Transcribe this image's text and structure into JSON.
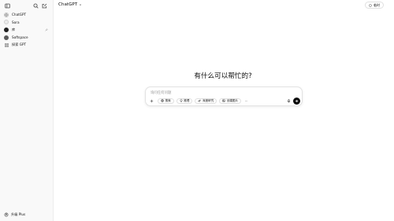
{
  "sidebar": {
    "items": [
      {
        "label": "ChatGPT",
        "icon": "chatgpt-logo-icon"
      },
      {
        "label": "Sora",
        "icon": "sora-avatar-icon"
      },
      {
        "label": "库",
        "icon": "avatar-icon",
        "pinned": true
      },
      {
        "label": "Softspace",
        "icon": "softspace-avatar-icon"
      },
      {
        "label": "探索 GPT",
        "icon": "grid-icon"
      }
    ],
    "bottom_label": "升级 Plus"
  },
  "header": {
    "model_label": "ChatGPT",
    "temp_chat_label": "临时"
  },
  "main": {
    "headline": "有什么可以帮忙的?",
    "composer": {
      "placeholder": "询问任何问题",
      "tools": [
        {
          "label": "搜索",
          "icon": "globe-icon"
        },
        {
          "label": "推理",
          "icon": "lightbulb-icon"
        },
        {
          "label": "深度研究",
          "icon": "telescope-icon"
        },
        {
          "label": "创建图片",
          "icon": "image-icon"
        }
      ],
      "more": "···"
    }
  }
}
